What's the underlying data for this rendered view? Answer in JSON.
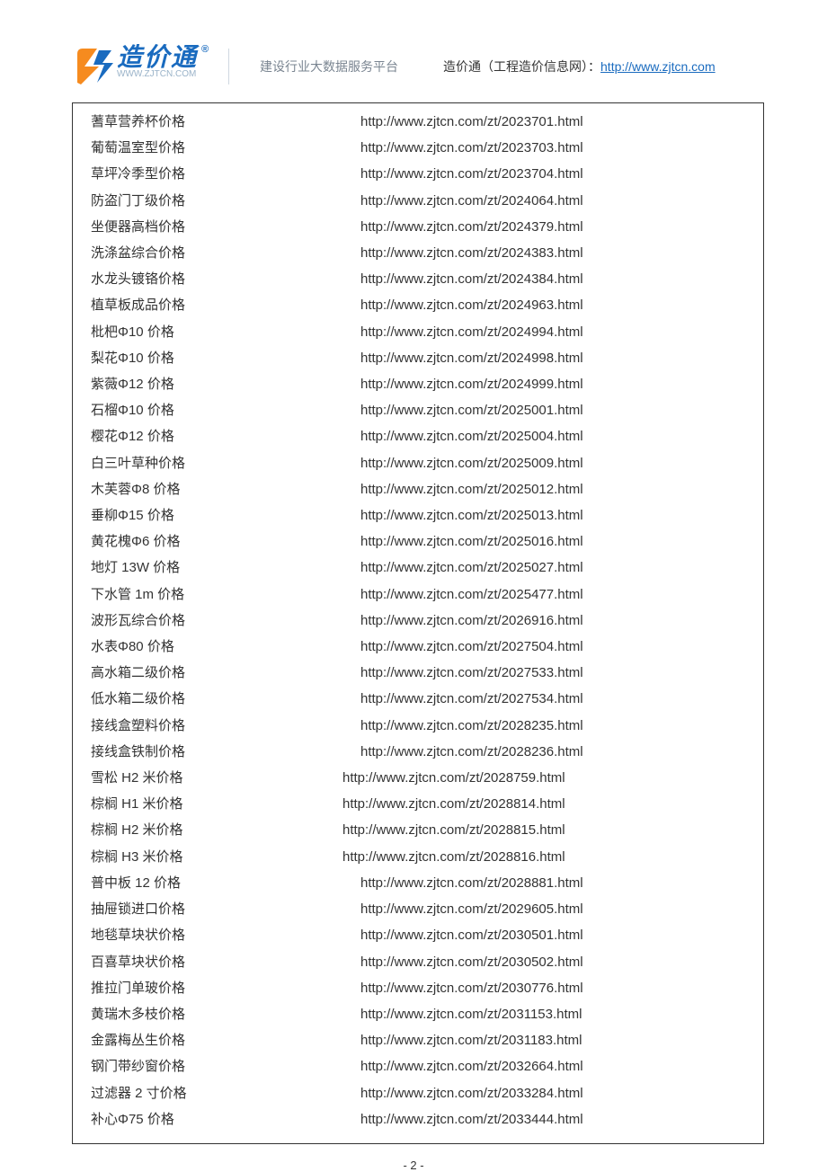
{
  "header": {
    "logo_cn": "造价通",
    "logo_url": "WWW.ZJTCN.COM",
    "tagline": "建设行业大数据服务平台",
    "site_label": "造价通（工程造价信息网）：",
    "site_link": "http://www.zjtcn.com"
  },
  "rows": [
    {
      "k": "a",
      "name": "蓍草营养杯价格",
      "url": "http://www.zjtcn.com/zt/2023701.html"
    },
    {
      "k": "a",
      "name": "葡萄温室型价格",
      "url": "http://www.zjtcn.com/zt/2023703.html"
    },
    {
      "k": "a",
      "name": "草坪冷季型价格",
      "url": "http://www.zjtcn.com/zt/2023704.html"
    },
    {
      "k": "a",
      "name": "防盗门丁级价格",
      "url": "http://www.zjtcn.com/zt/2024064.html"
    },
    {
      "k": "a",
      "name": "坐便器高档价格",
      "url": "http://www.zjtcn.com/zt/2024379.html"
    },
    {
      "k": "a",
      "name": "洗涤盆综合价格",
      "url": "http://www.zjtcn.com/zt/2024383.html"
    },
    {
      "k": "a",
      "name": "水龙头镀铬价格",
      "url": "http://www.zjtcn.com/zt/2024384.html"
    },
    {
      "k": "a",
      "name": "植草板成品价格",
      "url": "http://www.zjtcn.com/zt/2024963.html"
    },
    {
      "k": "a",
      "name": "枇杷Φ10 价格",
      "url": "http://www.zjtcn.com/zt/2024994.html"
    },
    {
      "k": "a",
      "name": "梨花Φ10 价格",
      "url": "http://www.zjtcn.com/zt/2024998.html"
    },
    {
      "k": "a",
      "name": "紫薇Φ12 价格",
      "url": "http://www.zjtcn.com/zt/2024999.html"
    },
    {
      "k": "a",
      "name": "石榴Φ10 价格",
      "url": "http://www.zjtcn.com/zt/2025001.html"
    },
    {
      "k": "a",
      "name": "樱花Φ12 价格",
      "url": "http://www.zjtcn.com/zt/2025004.html"
    },
    {
      "k": "a",
      "name": "白三叶草种价格",
      "url": "http://www.zjtcn.com/zt/2025009.html"
    },
    {
      "k": "a",
      "name": "木芙蓉Φ8 价格",
      "url": "http://www.zjtcn.com/zt/2025012.html"
    },
    {
      "k": "a",
      "name": "垂柳Φ15 价格",
      "url": "http://www.zjtcn.com/zt/2025013.html"
    },
    {
      "k": "a",
      "name": "黄花槐Φ6 价格",
      "url": "http://www.zjtcn.com/zt/2025016.html"
    },
    {
      "k": "a",
      "name": "地灯 13W 价格",
      "url": "http://www.zjtcn.com/zt/2025027.html"
    },
    {
      "k": "a",
      "name": "下水管 1m 价格",
      "url": "http://www.zjtcn.com/zt/2025477.html"
    },
    {
      "k": "a",
      "name": "波形瓦综合价格",
      "url": "http://www.zjtcn.com/zt/2026916.html"
    },
    {
      "k": "a",
      "name": "水表Φ80 价格",
      "url": "http://www.zjtcn.com/zt/2027504.html"
    },
    {
      "k": "a",
      "name": "高水箱二级价格",
      "url": "http://www.zjtcn.com/zt/2027533.html"
    },
    {
      "k": "a",
      "name": "低水箱二级价格",
      "url": "http://www.zjtcn.com/zt/2027534.html"
    },
    {
      "k": "a",
      "name": "接线盒塑料价格",
      "url": "http://www.zjtcn.com/zt/2028235.html"
    },
    {
      "k": "a",
      "name": "接线盒铁制价格",
      "url": "http://www.zjtcn.com/zt/2028236.html"
    },
    {
      "k": "b",
      "name": "雪松 H2 米价格",
      "url": "http://www.zjtcn.com/zt/2028759.html"
    },
    {
      "k": "b",
      "name": "棕榈 H1 米价格",
      "url": "http://www.zjtcn.com/zt/2028814.html"
    },
    {
      "k": "b",
      "name": "棕榈 H2 米价格",
      "url": "http://www.zjtcn.com/zt/2028815.html"
    },
    {
      "k": "b",
      "name": "棕榈 H3 米价格",
      "url": "http://www.zjtcn.com/zt/2028816.html"
    },
    {
      "k": "a",
      "name": "普中板 12 价格",
      "url": "http://www.zjtcn.com/zt/2028881.html"
    },
    {
      "k": "a",
      "name": "抽屉锁进口价格",
      "url": "http://www.zjtcn.com/zt/2029605.html"
    },
    {
      "k": "a",
      "name": "地毯草块状价格",
      "url": "http://www.zjtcn.com/zt/2030501.html"
    },
    {
      "k": "a",
      "name": "百喜草块状价格",
      "url": "http://www.zjtcn.com/zt/2030502.html"
    },
    {
      "k": "a",
      "name": "推拉门单玻价格",
      "url": "http://www.zjtcn.com/zt/2030776.html"
    },
    {
      "k": "a",
      "name": "黄瑞木多枝价格",
      "url": "http://www.zjtcn.com/zt/2031153.html"
    },
    {
      "k": "a",
      "name": "金露梅丛生价格",
      "url": "http://www.zjtcn.com/zt/2031183.html"
    },
    {
      "k": "a",
      "name": "钢门带纱窗价格",
      "url": "http://www.zjtcn.com/zt/2032664.html"
    },
    {
      "k": "a",
      "name": "过滤器 2 寸价格",
      "url": "http://www.zjtcn.com/zt/2033284.html"
    },
    {
      "k": "a",
      "name": "补心Φ75 价格",
      "url": "http://www.zjtcn.com/zt/2033444.html"
    }
  ],
  "footer": {
    "page_number": "- 2 -"
  }
}
